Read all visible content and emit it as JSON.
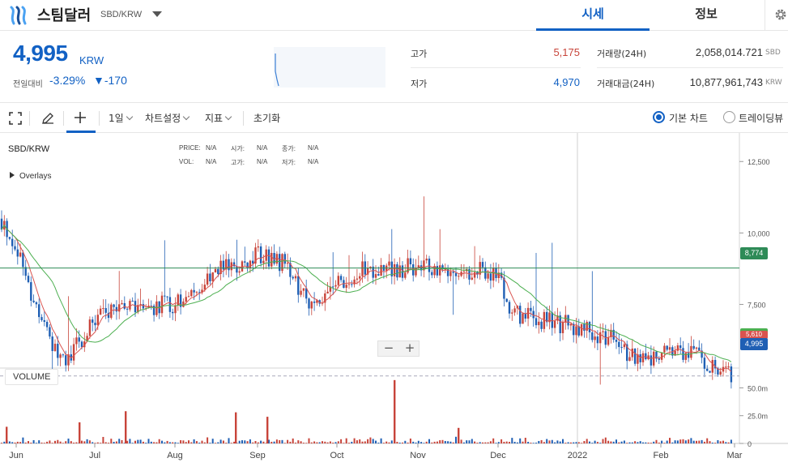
{
  "header": {
    "coin_name": "스팀달러",
    "pair": "SBD/KRW",
    "tabs": [
      "시세",
      "정보"
    ]
  },
  "summary": {
    "price": "4,995",
    "unit": "KRW",
    "change_label": "전일대비",
    "change_pct": "-3.29%",
    "change_abs": "▼-170",
    "high_label": "고가",
    "high": "5,175",
    "low_label": "저가",
    "low": "4,970",
    "volume_label": "거래량(24H)",
    "volume": "2,058,014.721",
    "volume_unit": "SBD",
    "value_label": "거래대금(24H)",
    "value": "10,877,961,743",
    "value_unit": "KRW"
  },
  "toolbar": {
    "interval": "1일",
    "chart_settings": "차트설정",
    "indicators": "지표",
    "reset": "초기화",
    "basic_chart": "기본 차트",
    "tradingview": "트레이딩뷰"
  },
  "chart": {
    "symbol": "SBD/KRW",
    "ohlc_labels": {
      "price": "PRICE:",
      "open": "시가:",
      "close": "종가:",
      "vol": "VOL:",
      "high": "고가:",
      "low": "저가:"
    },
    "ohlc_value": "N/A",
    "overlays": "Overlays",
    "volume_label": "VOLUME",
    "zoom_minus": "−",
    "zoom_plus": "+",
    "hline_tag": "8,774",
    "last_tag": "4,995",
    "ma_tag": "5,610",
    "colors": {
      "up": "#c8443a",
      "down": "#1f5fb4",
      "ma_short": "#d9534f",
      "ma_long": "#4caf50",
      "hline": "#2e8b57"
    }
  },
  "chart_data": {
    "type": "candlestick",
    "title": "SBD/KRW",
    "x_ticks": [
      "Jun",
      "Jul",
      "Aug",
      "Sep",
      "Oct",
      "Nov",
      "Dec",
      "2022",
      "Feb",
      "Mar"
    ],
    "y_ticks": [
      "12,500",
      "10,000",
      "7,500"
    ],
    "ylim": [
      5300,
      13500
    ],
    "volume_ticks": [
      "50.0m",
      "25.0m",
      "0"
    ],
    "volume_ylim": [
      0,
      62
    ],
    "horizontal_line": 8774,
    "last_price": 4995,
    "close_anchors": [
      {
        "date": "Jun",
        "close": 10500
      },
      {
        "date": "Jun 5",
        "close": 9600
      },
      {
        "date": "Jun 12",
        "close": 7800
      },
      {
        "date": "Jun 20",
        "close": 6100
      },
      {
        "date": "Jun 25",
        "close": 5600
      },
      {
        "date": "Jul",
        "close": 7100
      },
      {
        "date": "Jul 15",
        "close": 7400
      },
      {
        "date": "Aug",
        "close": 7500
      },
      {
        "date": "Aug 15",
        "close": 8600
      },
      {
        "date": "Sep",
        "close": 9200
      },
      {
        "date": "Sep 10",
        "close": 9000
      },
      {
        "date": "Sep 20",
        "close": 7300
      },
      {
        "date": "Oct",
        "close": 8200
      },
      {
        "date": "Oct 10",
        "close": 8800
      },
      {
        "date": "Oct 25",
        "close": 8700
      },
      {
        "date": "Nov",
        "close": 8900
      },
      {
        "date": "Nov 15",
        "close": 8700
      },
      {
        "date": "Dec",
        "close": 8600
      },
      {
        "date": "Dec 5",
        "close": 7200
      },
      {
        "date": "Dec 20",
        "close": 6900
      },
      {
        "date": "2022",
        "close": 6700
      },
      {
        "date": "Jan 15",
        "close": 6200
      },
      {
        "date": "Jan 25",
        "close": 5400
      },
      {
        "date": "Feb",
        "close": 5900
      },
      {
        "date": "Feb 10",
        "close": 5800
      },
      {
        "date": "Feb 20",
        "close": 5400
      },
      {
        "date": "Mar",
        "close": 4995
      }
    ],
    "volume_spikes_m": [
      {
        "date": "Jun 3",
        "volume": 15
      },
      {
        "date": "Jul 10",
        "volume": 19
      },
      {
        "date": "Jul 20",
        "volume": 29
      },
      {
        "date": "Aug 20",
        "volume": 28
      },
      {
        "date": "Sep 5",
        "volume": 24
      },
      {
        "date": "Oct 25",
        "volume": 57
      },
      {
        "date": "Nov 15",
        "volume": 14
      }
    ]
  }
}
